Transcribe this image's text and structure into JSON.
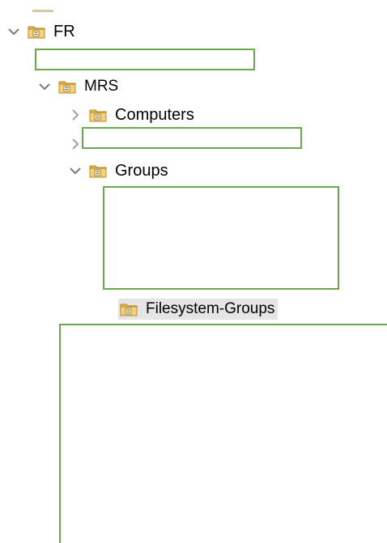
{
  "tree": {
    "root": {
      "label": "FR",
      "expanded": true
    },
    "mrs": {
      "label": "MRS",
      "expanded": true
    },
    "computers": {
      "label": "Computers",
      "expanded": false
    },
    "groups": {
      "label": "Groups",
      "expanded": true
    },
    "selected_item": {
      "label": "Filesystem-Groups",
      "selected": true
    }
  },
  "colors": {
    "redaction_border": "#6aa84f",
    "selection_bg": "#e5e5e5",
    "chevron": "#7a7a7a",
    "folder_body": "#e7b34a",
    "folder_front": "#f4d27a"
  },
  "icons": {
    "expand": "chevron-down-icon",
    "collapse": "chevron-right-icon",
    "folder": "folder-ou-icon"
  }
}
